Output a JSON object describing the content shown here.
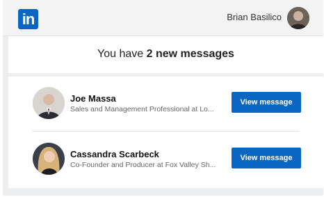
{
  "header": {
    "logo_text": "in",
    "user_name": "Brian Basilico"
  },
  "headline": {
    "prefix": "You have ",
    "emphasis": "2 new messages"
  },
  "messages": [
    {
      "name": "Joe Massa",
      "subtitle": "Sales and Management Professional at Lo...",
      "button": "View message"
    },
    {
      "name": "Cassandra Scarbeck",
      "subtitle": "Co-Founder and Producer at Fox Valley Sh...",
      "button": "View message"
    }
  ],
  "colors": {
    "brand": "#0a66c2",
    "background": "#edeef0"
  }
}
